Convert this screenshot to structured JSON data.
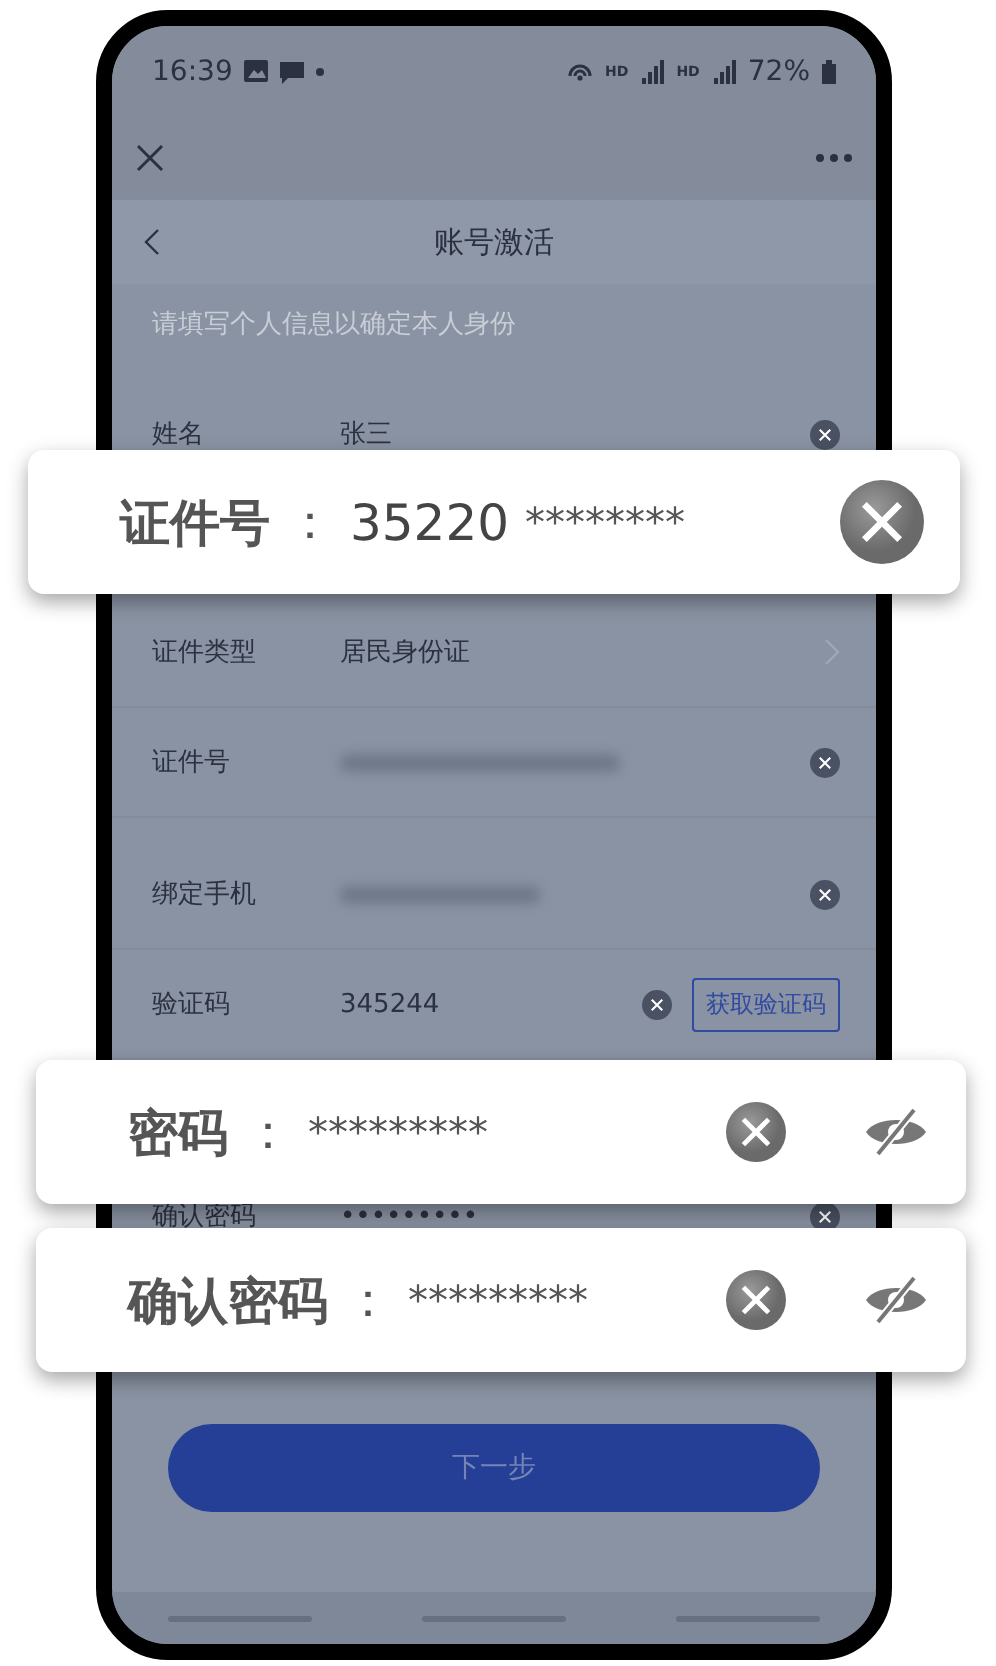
{
  "status_bar": {
    "time": "16:39",
    "network_labels": [
      "HD",
      "HD"
    ],
    "battery": "72%"
  },
  "header": {
    "title": "账号激活"
  },
  "hint": "请填写个人信息以确定本人身份",
  "sections": [
    {
      "rows": [
        {
          "kind": "text",
          "label": "姓名",
          "value": "张三"
        }
      ]
    },
    {
      "rows": [
        {
          "kind": "select",
          "label": "证件类型",
          "value": "居民身份证"
        },
        {
          "kind": "blurred",
          "label": "证件号"
        }
      ]
    },
    {
      "rows": [
        {
          "kind": "blurred",
          "label": "绑定手机"
        },
        {
          "kind": "code",
          "label": "验证码",
          "value": "345244",
          "action": "获取验证码"
        }
      ]
    },
    {
      "rows": [
        {
          "kind": "password",
          "label": "确认密码",
          "value": "•••••••••"
        }
      ]
    }
  ],
  "next_button": "下一步",
  "callouts": [
    {
      "label": "证件号",
      "colon": "：",
      "value": "35220",
      "mask": "********",
      "toggle": false
    },
    {
      "label": "密码",
      "colon": "：",
      "mask": "*********",
      "toggle": true,
      "password_visible": false
    },
    {
      "label": "确认密码",
      "colon": "：",
      "mask": "*********",
      "toggle": true,
      "password_visible": false
    }
  ]
}
